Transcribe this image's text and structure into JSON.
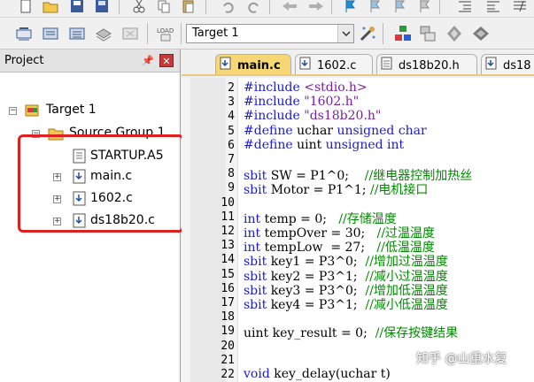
{
  "toolbar": {
    "target_select": "Target 1"
  },
  "project_panel": {
    "title": "Project",
    "pin_icon": "pin-icon",
    "close_icon": "close-icon",
    "tree": {
      "root": "Target 1",
      "group": "Source Group 1",
      "files": [
        "STARTUP.A5",
        "main.c",
        "1602.c",
        "ds18b20.c"
      ]
    }
  },
  "tabs": [
    {
      "label": "main.c",
      "active": true
    },
    {
      "label": "1602.c",
      "active": false
    },
    {
      "label": "ds18b20.h",
      "active": false
    },
    {
      "label": "ds18",
      "active": false
    }
  ],
  "code": {
    "lines": [
      {
        "n": "2",
        "parts": [
          [
            "pp",
            "#include "
          ],
          [
            "str",
            "<stdio.h>"
          ]
        ]
      },
      {
        "n": "3",
        "parts": [
          [
            "pp",
            "#include "
          ],
          [
            "str",
            "\"1602.h\""
          ]
        ]
      },
      {
        "n": "4",
        "parts": [
          [
            "pp",
            "#include "
          ],
          [
            "str",
            "\"ds18b20.h\""
          ]
        ]
      },
      {
        "n": "5",
        "parts": [
          [
            "pp",
            "#define "
          ],
          [
            "",
            "uchar "
          ],
          [
            "kw",
            "unsigned char"
          ]
        ]
      },
      {
        "n": "6",
        "parts": [
          [
            "pp",
            "#define "
          ],
          [
            "",
            "uint "
          ],
          [
            "kw",
            "unsigned int"
          ]
        ]
      },
      {
        "n": "7",
        "parts": []
      },
      {
        "n": "8",
        "parts": [
          [
            "kw",
            "sbit"
          ],
          [
            "",
            " SW = P1^0;    "
          ],
          [
            "cm",
            "//继电器控制加热丝"
          ]
        ]
      },
      {
        "n": "9",
        "parts": [
          [
            "kw",
            "sbit"
          ],
          [
            "",
            " Motor = P1^1; "
          ],
          [
            "cm",
            "//电机接口"
          ]
        ]
      },
      {
        "n": "10",
        "parts": []
      },
      {
        "n": "11",
        "parts": [
          [
            "kw",
            "int"
          ],
          [
            "",
            " temp = 0;   "
          ],
          [
            "cm",
            "//存储温度"
          ]
        ]
      },
      {
        "n": "12",
        "parts": [
          [
            "kw",
            "int"
          ],
          [
            "",
            " tempOver = 30;   "
          ],
          [
            "cm",
            "//过温温度"
          ]
        ]
      },
      {
        "n": "13",
        "parts": [
          [
            "kw",
            "int"
          ],
          [
            "",
            " tempLow  = 27;   "
          ],
          [
            "cm",
            "//低温温度"
          ]
        ]
      },
      {
        "n": "14",
        "parts": [
          [
            "kw",
            "sbit"
          ],
          [
            "",
            " key1 = P3^0;  "
          ],
          [
            "cm",
            "//增加过温温度"
          ]
        ]
      },
      {
        "n": "15",
        "parts": [
          [
            "kw",
            "sbit"
          ],
          [
            "",
            " key2 = P3^1;  "
          ],
          [
            "cm",
            "//减小过温温度"
          ]
        ]
      },
      {
        "n": "16",
        "parts": [
          [
            "kw",
            "sbit"
          ],
          [
            "",
            " key3 = P3^0;  "
          ],
          [
            "cm",
            "//增加低温温度"
          ]
        ]
      },
      {
        "n": "17",
        "parts": [
          [
            "kw",
            "sbit"
          ],
          [
            "",
            " key4 = P3^1;  "
          ],
          [
            "cm",
            "//减小低温温度"
          ]
        ]
      },
      {
        "n": "18",
        "parts": []
      },
      {
        "n": "19",
        "parts": [
          [
            "",
            "uint key_result = 0;  "
          ],
          [
            "cm",
            "//保存按键结果"
          ]
        ]
      },
      {
        "n": "20",
        "parts": []
      },
      {
        "n": "21",
        "parts": []
      },
      {
        "n": "22",
        "parts": [
          [
            "kw",
            "void"
          ],
          [
            "",
            " key_delay(uchar t)"
          ]
        ]
      }
    ]
  },
  "watermark": "知乎 @山重水复",
  "colors": {
    "keyword": "#1a1ad6",
    "string": "#7a1fa2",
    "comment": "#008a00",
    "highlight_box": "#e02020",
    "active_tab": "#f7d774"
  }
}
